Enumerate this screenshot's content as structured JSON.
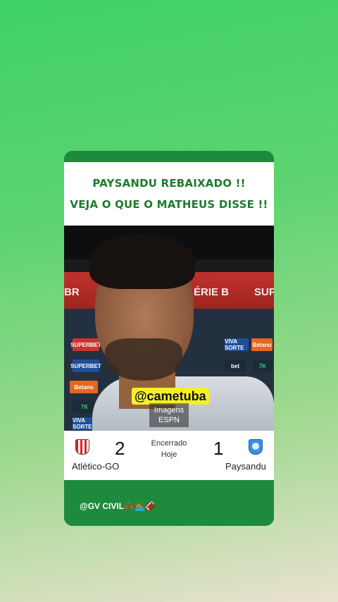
{
  "post": {
    "headline_line1": "PAYSANDU REBAIXADO !!",
    "headline_line2": "VEJA O QUE O MATHEUS DISSE !!"
  },
  "video": {
    "banner_left": "BR",
    "banner_mid": "ÉRIE B",
    "banner_right": "SUP",
    "sponsors": [
      "SUPERBET",
      "Betano",
      "VIVA SORTE",
      "Betano",
      "7K",
      "bet",
      "7K",
      "VIVA SORTE",
      "SUPERBET"
    ],
    "overlay_handle": "@cametuba",
    "source_line1": "Imagens",
    "source_line2": "ESPN"
  },
  "match": {
    "home_team": "Atlético-GO",
    "home_score": "2",
    "away_team": "Paysandu",
    "away_score": "1",
    "status": "Encerrado",
    "date": "Hoje",
    "colors": {
      "home_crest": "#d22222",
      "away_crest": "#3b8fe0"
    }
  },
  "footer": {
    "credit": "@GV CIVIL🙌🏾🏊🏾🏈"
  },
  "theme": {
    "background_top": "#3ed164",
    "background_bottom": "#e9e2cf",
    "card_green": "#1e8a3c",
    "headline_green": "#1f7a2e",
    "tag_yellow": "#f4ef2a"
  }
}
